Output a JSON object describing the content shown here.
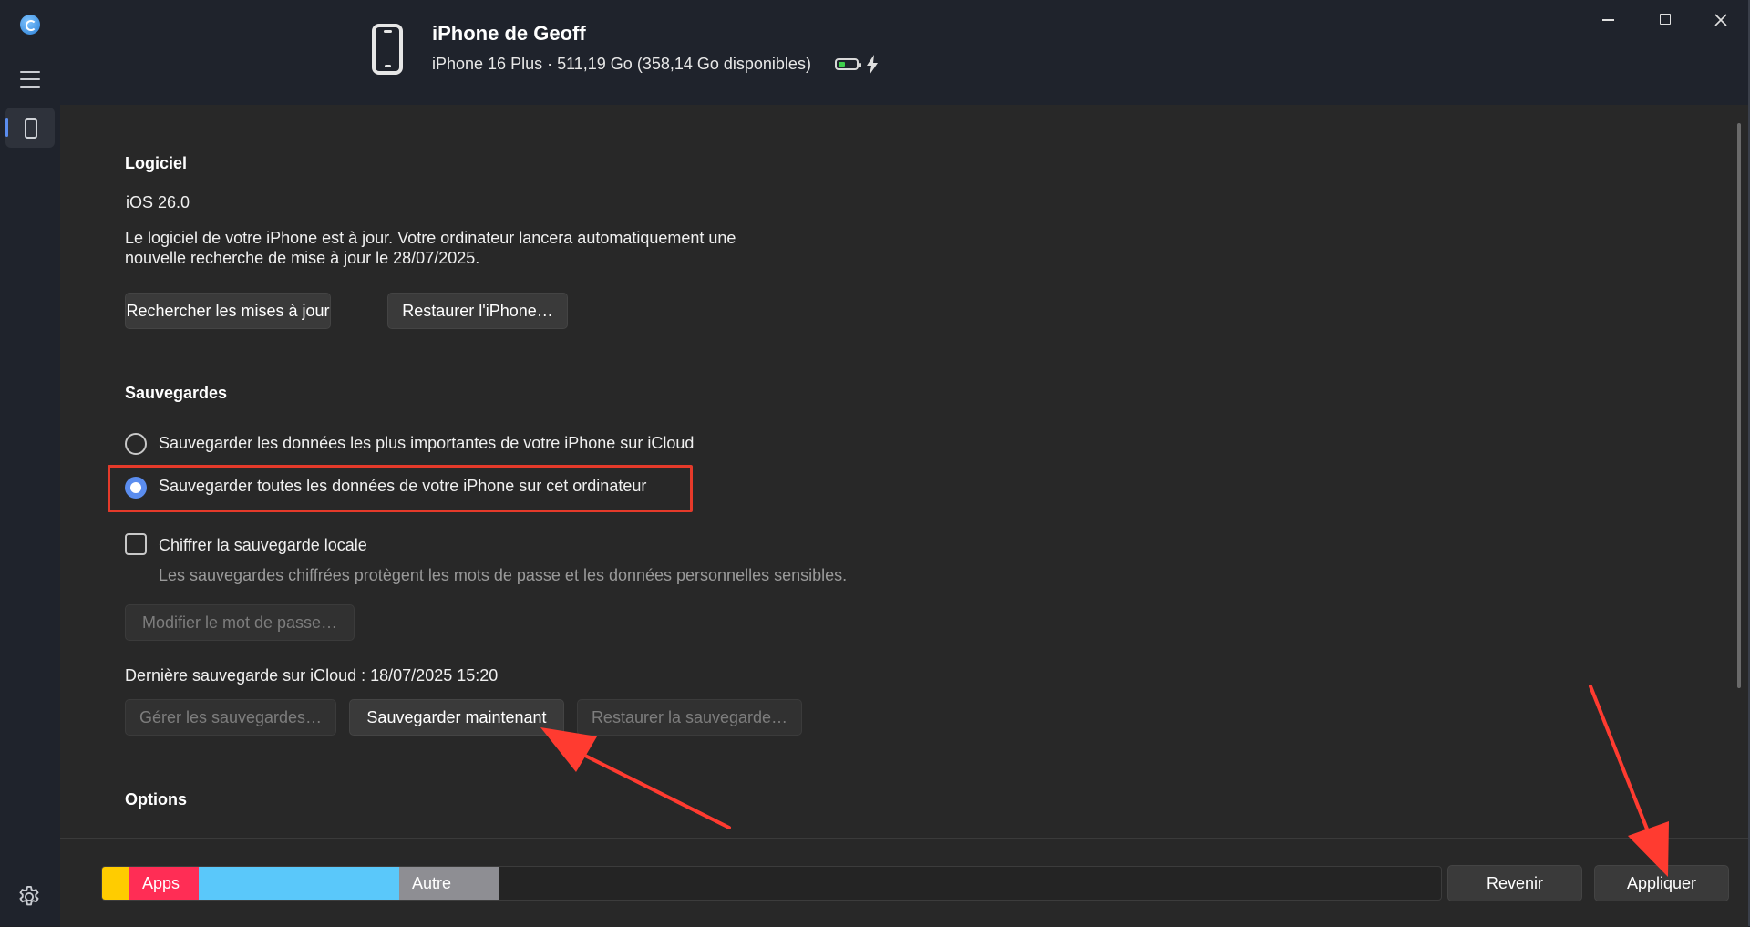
{
  "window": {
    "device_name": "iPhone de Geoff",
    "device_info": "iPhone 16 Plus · 511,19 Go (358,14 Go disponibles)",
    "battery_level": 0.4,
    "charging": true
  },
  "software": {
    "title": "Logiciel",
    "version": "iOS 26.0",
    "status_line1": "Le logiciel de votre iPhone est à jour. Votre ordinateur lancera automatiquement une",
    "status_line2": "nouvelle recherche de mise à jour le 28/07/2025.",
    "check_updates_label": "Rechercher les mises à jour",
    "restore_label": "Restaurer l'iPhone…"
  },
  "backups": {
    "title": "Sauvegardes",
    "option_icloud": "Sauvegarder les données les plus importantes de votre iPhone sur iCloud",
    "option_computer": "Sauvegarder toutes les données de votre iPhone sur cet ordinateur",
    "selected_option": "computer",
    "encrypt_label": "Chiffrer la sauvegarde locale",
    "encrypt_checked": false,
    "encrypt_hint": "Les sauvegardes chiffrées protègent les mots de passe et les données personnelles sensibles.",
    "change_password_label": "Modifier le mot de passe…",
    "last_backup": "Dernière sauvegarde sur iCloud : 18/07/2025 15:20",
    "manage_label": "Gérer les sauvegardes…",
    "backup_now_label": "Sauvegarder maintenant",
    "restore_backup_label": "Restaurer la sauvegarde…"
  },
  "options": {
    "title": "Options"
  },
  "storage": {
    "segments": [
      {
        "label": "",
        "color": "#ffcc00"
      },
      {
        "label": "Apps",
        "color": "#ff2d55"
      },
      {
        "label": "",
        "color": "#5ac8fa"
      },
      {
        "label": "Autre",
        "color": "#8e8e93"
      }
    ]
  },
  "footer": {
    "revert_label": "Revenir",
    "apply_label": "Appliquer"
  },
  "icons": {
    "app_logo": "sync-icon",
    "menu": "hamburger-icon",
    "device": "iphone-icon",
    "settings": "gear-icon",
    "battery": "battery-icon",
    "charging": "lightning-icon"
  },
  "colors": {
    "accent": "#5b8def",
    "annotation": "#e53a2a",
    "battery": "#3ecf4c"
  }
}
